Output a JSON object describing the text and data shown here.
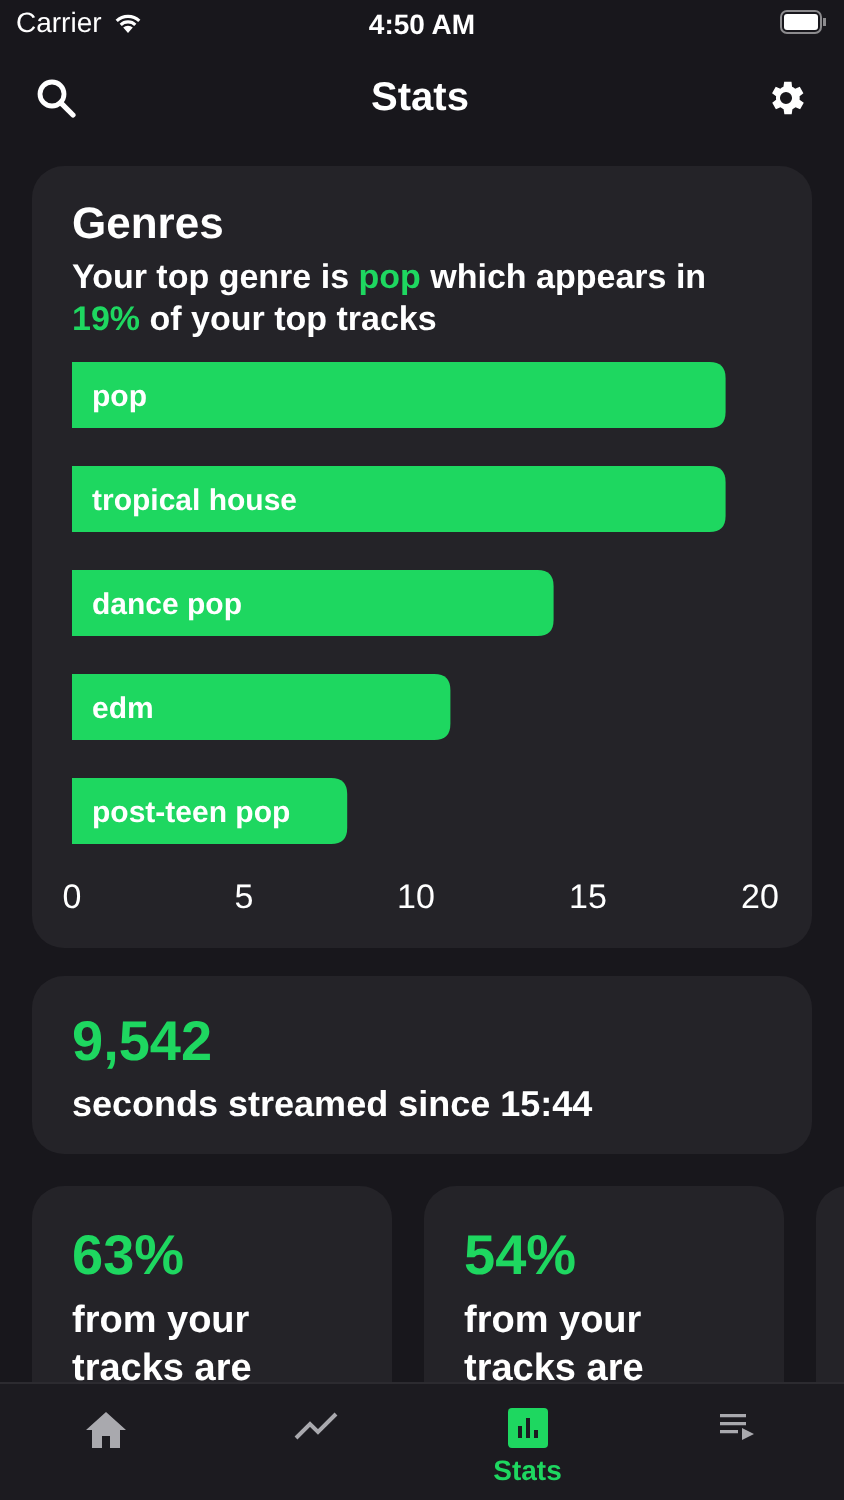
{
  "status_bar": {
    "carrier": "Carrier",
    "time": "4:50 AM"
  },
  "nav": {
    "title": "Stats"
  },
  "genres": {
    "title": "Genres",
    "subtitle": "Your top genre is **pop** which appears in **19%** of your top tracks",
    "chart_data": {
      "type": "bar",
      "orientation": "horizontal",
      "categories": [
        "pop",
        "tropical house",
        "dance pop",
        "edm",
        "post-teen pop"
      ],
      "series": [
        {
          "color": "#1ed760",
          "values": [
            19,
            19,
            14,
            11,
            8
          ]
        }
      ],
      "xlim": [
        0,
        20
      ],
      "xticks": [
        0,
        5,
        10,
        15,
        20
      ]
    }
  },
  "streams": {
    "value": "9,542",
    "caption": "seconds streamed since 15:44"
  },
  "stat_cards": [
    {
      "value": "63%",
      "caption": "from your tracks are"
    },
    {
      "value": "54%",
      "caption": "from your tracks are"
    }
  ],
  "tabs": [
    {
      "selected": false
    },
    {
      "selected": false
    },
    {
      "label": "Stats",
      "selected": true
    },
    {
      "selected": false
    }
  ]
}
